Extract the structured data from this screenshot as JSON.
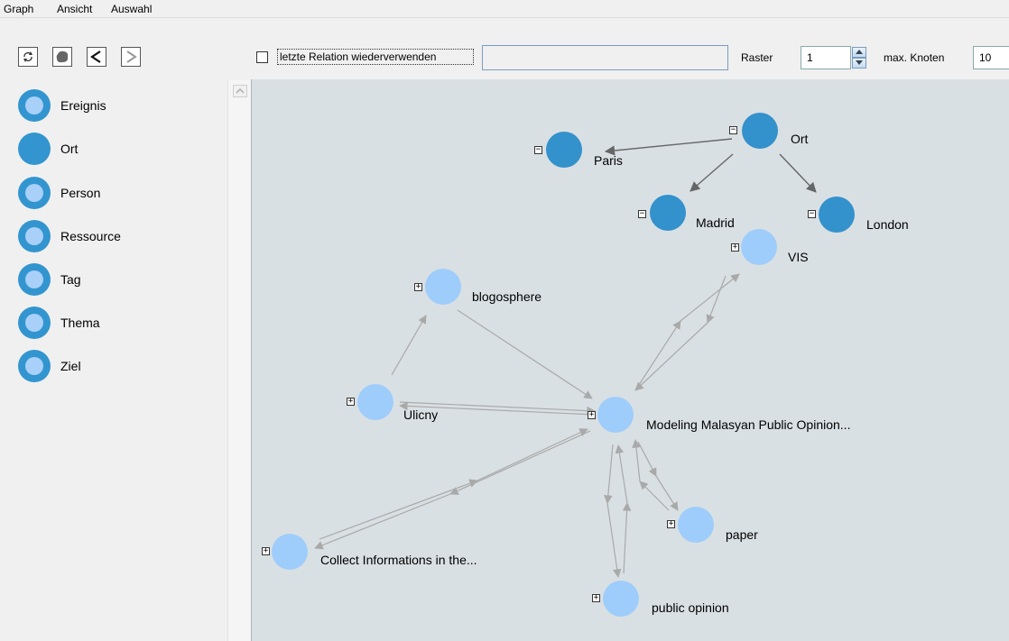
{
  "menubar": {
    "items": [
      "Graph",
      "Ansicht",
      "Auswahl"
    ]
  },
  "toolbar": {
    "reuse_relation_label": "letzte Relation wiederverwenden",
    "reuse_relation_checked": false,
    "relation_field_value": "",
    "raster_label": "Raster",
    "raster_value": "1",
    "max_nodes_label": "max. Knoten",
    "max_nodes_value": "10"
  },
  "palette": {
    "items": [
      {
        "label": "Ereignis",
        "style": "ring"
      },
      {
        "label": "Ort",
        "style": "solid"
      },
      {
        "label": "Person",
        "style": "ring"
      },
      {
        "label": "Ressource",
        "style": "ring"
      },
      {
        "label": "Tag",
        "style": "ring"
      },
      {
        "label": "Thema",
        "style": "ring"
      },
      {
        "label": "Ziel",
        "style": "ring"
      }
    ]
  },
  "graph": {
    "nodes": {
      "ort": {
        "label": "Ort",
        "expander": "minus",
        "kind": "dark"
      },
      "paris": {
        "label": "Paris",
        "expander": "minus",
        "kind": "dark"
      },
      "madrid": {
        "label": "Madrid",
        "expander": "minus",
        "kind": "dark"
      },
      "london": {
        "label": "London",
        "expander": "minus",
        "kind": "dark"
      },
      "vis": {
        "label": "VIS",
        "expander": "plus",
        "kind": "light"
      },
      "blogosphere": {
        "label": "blogosphere",
        "expander": "plus",
        "kind": "light"
      },
      "ulicny": {
        "label": "Ulicny",
        "expander": "plus",
        "kind": "light"
      },
      "modeling": {
        "label": "Modeling Malasyan Public Opinion...",
        "expander": "plus",
        "kind": "light"
      },
      "collect": {
        "label": "Collect Informations in the...",
        "expander": "plus",
        "kind": "light"
      },
      "paper": {
        "label": "paper",
        "expander": "plus",
        "kind": "light"
      },
      "public_opinion": {
        "label": "public opinion",
        "expander": "plus",
        "kind": "light"
      }
    },
    "edges": [
      [
        "ort",
        "paris"
      ],
      [
        "ort",
        "madrid"
      ],
      [
        "ort",
        "london"
      ],
      [
        "ulicny",
        "blogosphere"
      ],
      [
        "blogosphere",
        "modeling"
      ],
      [
        "modeling",
        "ulicny"
      ],
      [
        "ulicny",
        "modeling"
      ],
      [
        "modeling",
        "vis"
      ],
      [
        "vis",
        "modeling"
      ],
      [
        "modeling",
        "collect"
      ],
      [
        "collect",
        "modeling"
      ],
      [
        "modeling",
        "paper"
      ],
      [
        "paper",
        "modeling"
      ],
      [
        "modeling",
        "public_opinion"
      ],
      [
        "public_opinion",
        "modeling"
      ]
    ]
  },
  "colors": {
    "dark_node": "#3391cc",
    "light_node": "#9fcdfb",
    "canvas": "#d9e0e3",
    "edge_dark": "#666666",
    "edge_light": "#a9a9a9"
  }
}
